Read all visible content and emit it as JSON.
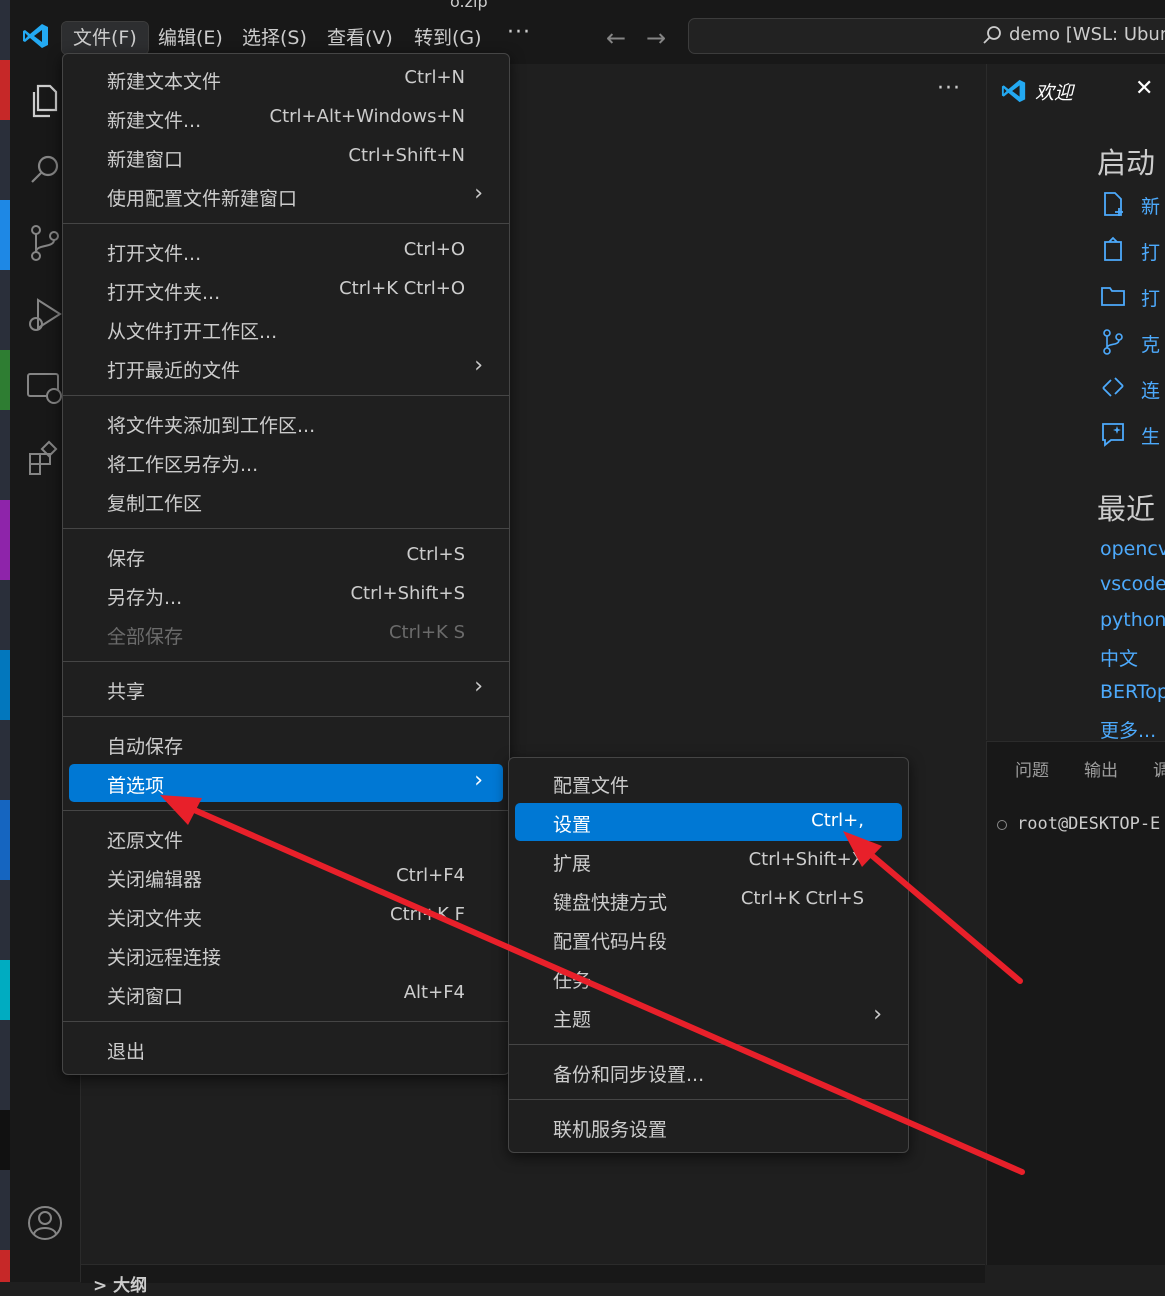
{
  "window": {
    "title_fragment": "o.zip"
  },
  "menubar": {
    "items": [
      "文件(F)",
      "编辑(E)",
      "选择(S)",
      "查看(V)",
      "转到(G)"
    ],
    "more": "···"
  },
  "command_center": {
    "text": "demo [WSL: Ubuntu"
  },
  "editor": {
    "more": "···",
    "outline_label": "> 大纲"
  },
  "file_menu": {
    "items": [
      {
        "label": "新建文本文件",
        "key": "Ctrl+N"
      },
      {
        "label": "新建文件...",
        "key": "Ctrl+Alt+Windows+N"
      },
      {
        "label": "新建窗口",
        "key": "Ctrl+Shift+N"
      },
      {
        "label": "使用配置文件新建窗口",
        "key": "",
        "arrow": "›"
      },
      {
        "label": "打开文件...",
        "key": "Ctrl+O"
      },
      {
        "label": "打开文件夹...",
        "key": "Ctrl+K Ctrl+O"
      },
      {
        "label": "从文件打开工作区...",
        "key": ""
      },
      {
        "label": "打开最近的文件",
        "key": "",
        "arrow": "›"
      },
      {
        "label": "将文件夹添加到工作区...",
        "key": ""
      },
      {
        "label": "将工作区另存为...",
        "key": ""
      },
      {
        "label": "复制工作区",
        "key": ""
      },
      {
        "label": "保存",
        "key": "Ctrl+S"
      },
      {
        "label": "另存为...",
        "key": "Ctrl+Shift+S"
      },
      {
        "label": "全部保存",
        "key": "Ctrl+K S"
      },
      {
        "label": "共享",
        "key": "",
        "arrow": "›"
      },
      {
        "label": "自动保存",
        "key": ""
      },
      {
        "label": "首选项",
        "key": "",
        "arrow": "›"
      },
      {
        "label": "还原文件",
        "key": ""
      },
      {
        "label": "关闭编辑器",
        "key": "Ctrl+F4"
      },
      {
        "label": "关闭文件夹",
        "key": "Ctrl+K F"
      },
      {
        "label": "关闭远程连接",
        "key": ""
      },
      {
        "label": "关闭窗口",
        "key": "Alt+F4"
      },
      {
        "label": "退出",
        "key": ""
      }
    ]
  },
  "preferences_submenu": {
    "items": [
      {
        "label": "配置文件",
        "key": ""
      },
      {
        "label": "设置",
        "key": "Ctrl+,"
      },
      {
        "label": "扩展",
        "key": "Ctrl+Shift+X"
      },
      {
        "label": "键盘快捷方式",
        "key": "Ctrl+K Ctrl+S"
      },
      {
        "label": "配置代码片段",
        "key": ""
      },
      {
        "label": "任务",
        "key": ""
      },
      {
        "label": "主题",
        "key": "",
        "arrow": "›"
      },
      {
        "label": "备份和同步设置...",
        "key": ""
      },
      {
        "label": "联机服务设置",
        "key": ""
      }
    ]
  },
  "welcome": {
    "tab_title": "欢迎",
    "close": "✕",
    "start_heading": "启动",
    "start_items": [
      "新",
      "打",
      "打",
      "克",
      "连",
      "生"
    ],
    "recent_heading": "最近",
    "recent_items": [
      "opencv-",
      "vscode_",
      "python",
      "中文",
      "BERTopi",
      "更多..."
    ]
  },
  "panel": {
    "tabs": [
      "问题",
      "输出",
      "调"
    ],
    "terminal_line": "root@DESKTOP-E"
  },
  "colors": {
    "accent": "#0078d4",
    "link": "#4daafc",
    "annotation_arrow": "#e8202a"
  }
}
